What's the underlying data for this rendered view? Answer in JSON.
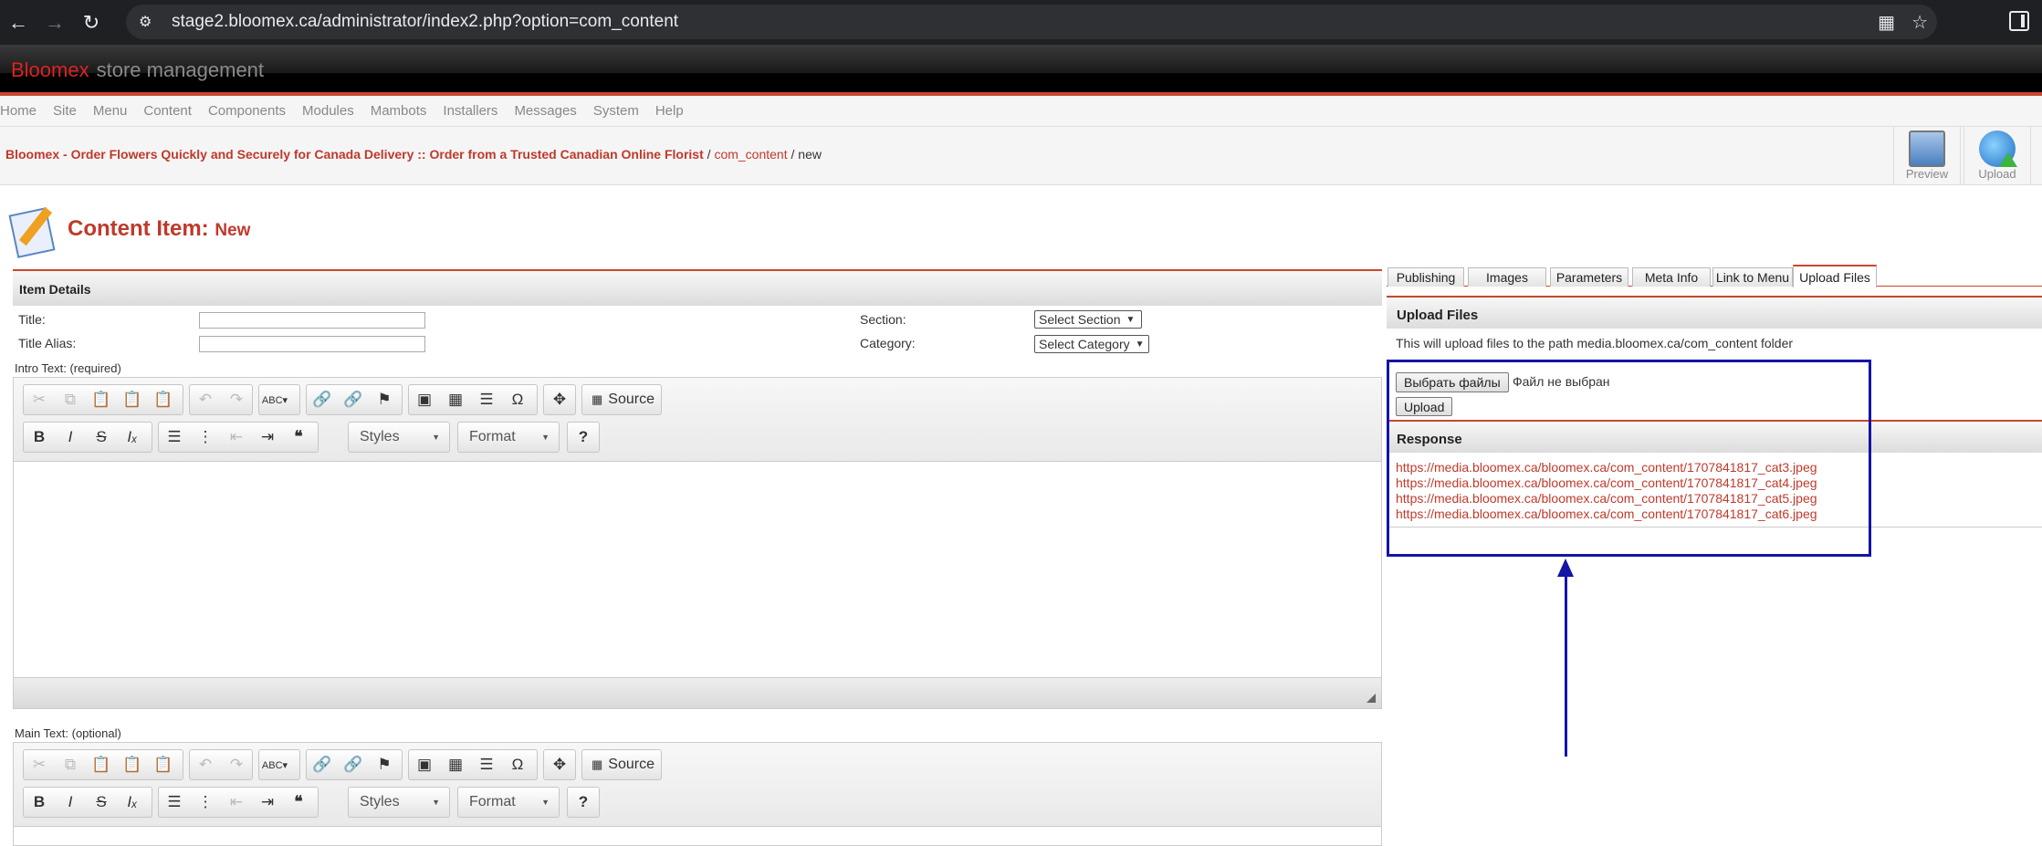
{
  "browser": {
    "url": "stage2.bloomex.ca/administrator/index2.php?option=com_content",
    "back_icon": "back-arrow-icon",
    "forward_icon": "forward-arrow-icon",
    "reload_icon": "reload-icon"
  },
  "header": {
    "brand_name": "Bloomex",
    "brand_suffix": "store management"
  },
  "menubar": {
    "items": [
      "Home",
      "Site",
      "Menu",
      "Content",
      "Components",
      "Modules",
      "Mambots",
      "Installers",
      "Messages",
      "System",
      "Help"
    ]
  },
  "breadcrumb": {
    "site": "Bloomex - Order Flowers Quickly and Securely for Canada Delivery :: Order from a Trusted Canadian Online Florist",
    "sep1": " / ",
    "component": "com_content",
    "sep2": " / ",
    "current": "new"
  },
  "toolbar": {
    "preview_label": "Preview",
    "upload_label": "Upload"
  },
  "page": {
    "title": "Content Item:",
    "subtitle": "New"
  },
  "item_details": {
    "heading": "Item Details",
    "title_label": "Title:",
    "title_value": "",
    "alias_label": "Title Alias:",
    "alias_value": "",
    "section_label": "Section:",
    "section_value": "Select Section",
    "category_label": "Category:",
    "category_value": "Select Category",
    "intro_label": "Intro Text: (required)",
    "main_label": "Main Text: (optional)"
  },
  "editor": {
    "source_label": "Source",
    "styles_label": "Styles",
    "format_label": "Format",
    "help_label": "?"
  },
  "tabs": {
    "items": [
      "Publishing",
      "Images",
      "Parameters",
      "Meta Info",
      "Link to Menu",
      "Upload Files"
    ],
    "active": "Upload Files"
  },
  "upload": {
    "heading": "Upload Files",
    "description": "This will upload files to the path media.bloomex.ca/com_content folder",
    "choose_button": "Выбрать файлы",
    "no_file": "Файл не выбран",
    "upload_button": "Upload"
  },
  "response": {
    "heading": "Response",
    "links": [
      "https://media.bloomex.ca/bloomex.ca/com_content/1707841817_cat3.jpeg",
      "https://media.bloomex.ca/bloomex.ca/com_content/1707841817_cat4.jpeg",
      "https://media.bloomex.ca/bloomex.ca/com_content/1707841817_cat5.jpeg",
      "https://media.bloomex.ca/bloomex.ca/com_content/1707841817_cat6.jpeg"
    ]
  },
  "annotation": {
    "color": "#1414a6"
  }
}
